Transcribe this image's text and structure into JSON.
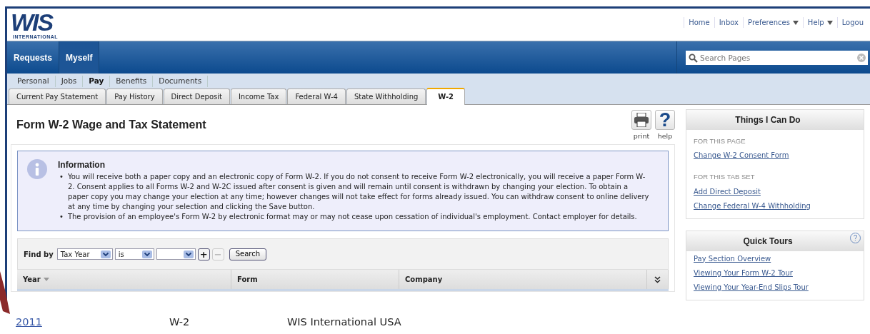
{
  "logo": {
    "name": "WIS",
    "tagline": "INTERNATIONAL"
  },
  "top_links": [
    {
      "label": "Home",
      "dropdown": false
    },
    {
      "label": "Inbox",
      "dropdown": false
    },
    {
      "label": "Preferences",
      "dropdown": true
    },
    {
      "label": "Help",
      "dropdown": true
    },
    {
      "label": "Logou",
      "dropdown": false
    }
  ],
  "nav": [
    {
      "label": "Requests",
      "selected": false
    },
    {
      "label": "Myself",
      "selected": true
    }
  ],
  "search": {
    "placeholder": "Search Pages"
  },
  "subnav": [
    {
      "label": "Personal",
      "selected": false
    },
    {
      "label": "Jobs",
      "selected": false
    },
    {
      "label": "Pay",
      "selected": true
    },
    {
      "label": "Benefits",
      "selected": false
    },
    {
      "label": "Documents",
      "selected": false
    }
  ],
  "tabs": [
    {
      "label": "Current Pay Statement",
      "selected": false
    },
    {
      "label": "Pay History",
      "selected": false
    },
    {
      "label": "Direct Deposit",
      "selected": false
    },
    {
      "label": "Income Tax",
      "selected": false
    },
    {
      "label": "Federal W-4",
      "selected": false
    },
    {
      "label": "State Withholding",
      "selected": false
    },
    {
      "label": "W-2",
      "selected": true
    }
  ],
  "page_title": "Form W-2 Wage and Tax Statement",
  "toolbar": [
    {
      "kind": "print",
      "label": "print"
    },
    {
      "kind": "help",
      "label": "help",
      "glyph": "?"
    }
  ],
  "info": {
    "title": "Information",
    "bullets": [
      {
        "marker": "•",
        "text": "You will receive both a paper copy and an electronic copy of Form W-2. If you do not consent to receive Form W-2 electronically, you will receive a paper Form W-2. Consent applies to all Forms W-2 and W-2C issued after consent is given and will remain until consent is withdrawn by changing your election. To obtain a paper copy you may change your election at any time; however changes will not take effect for forms already issued. You can withdraw consent to online delivery at any time by changing your selection and clicking the Save button."
      },
      {
        "marker": "•",
        "text": "The provision of an employee's Form W-2 by electronic format may or may not cease upon cessation of individual's employment. Contact employer for details."
      }
    ]
  },
  "filter": {
    "label": "Find by",
    "controls": [
      {
        "kind": "select",
        "value": "Tax Year"
      },
      {
        "kind": "select",
        "value": "is"
      },
      {
        "kind": "select"
      },
      {
        "kind": "add",
        "glyph": "+",
        "disabled": false
      },
      {
        "kind": "remove",
        "glyph": "−",
        "disabled": true
      },
      {
        "kind": "button",
        "label": "Search"
      }
    ]
  },
  "table": {
    "columns": [
      {
        "label": "Year",
        "sorted": true
      },
      {
        "label": "Form",
        "sorted": false
      },
      {
        "label": "Company",
        "sorted": false
      }
    ],
    "rows": [
      [
        "2011",
        "W-2",
        "WIS International USA"
      ]
    ]
  },
  "sidebar": [
    {
      "title": "Things I Can Do",
      "sections": [
        {
          "heading": "FOR THIS PAGE",
          "links": [
            "Change W-2 Consent Form"
          ]
        },
        {
          "heading": "FOR THIS TAB SET",
          "links": [
            "Add Direct Deposit",
            "Change Federal W-4 Withholding"
          ]
        }
      ]
    },
    {
      "title": "Quick Tours",
      "glyph": "?",
      "sections": [
        {
          "links": [
            "Pay Section Overview",
            "Viewing Your Form W-2 Tour",
            "Viewing Your Year-End Slips Tour"
          ]
        }
      ]
    }
  ]
}
